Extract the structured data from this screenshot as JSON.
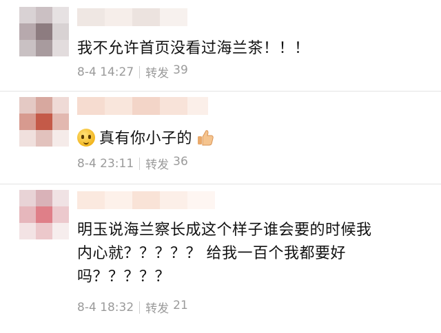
{
  "comments": [
    {
      "text": "我不允许首页没看过海兰茶！！！",
      "time": "8-4 14:27",
      "repost_label": "转发",
      "repost_count": "39"
    },
    {
      "text": "真有你小子的",
      "leading_emoji": "thinking-face-icon",
      "trailing_emoji": "thumbs-up-icon",
      "time": "8-4 23:11",
      "repost_label": "转发",
      "repost_count": "36"
    },
    {
      "text_lines": [
        "明玉说海兰察长成这个样子谁会要的时候我",
        "内心就？？？？？ 给我一百个我都要好",
        "吗？？？？？"
      ],
      "time": "8-4 18:32",
      "repost_label": "转发",
      "repost_count": "21"
    }
  ]
}
